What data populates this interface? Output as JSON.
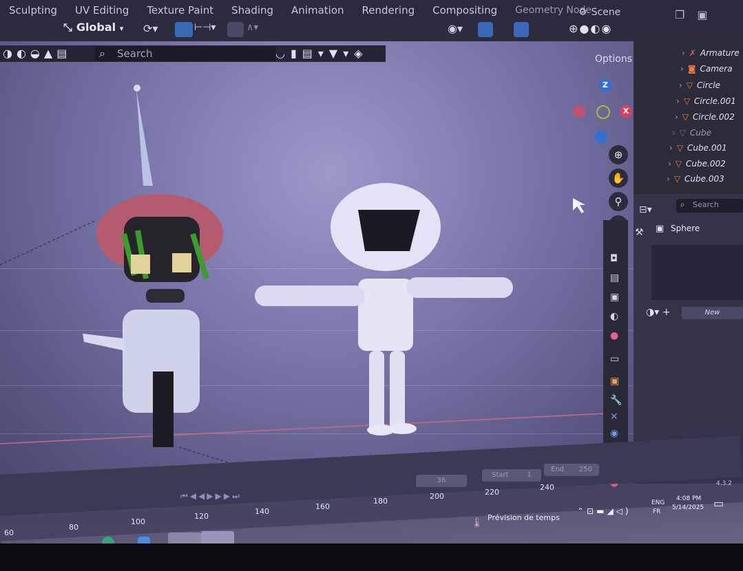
{
  "workspace_tabs": [
    "Sculpting",
    "UV Editing",
    "Texture Paint",
    "Shading",
    "Animation",
    "Rendering",
    "Compositing",
    "Geometry Node"
  ],
  "scene_label": "Scene",
  "header": {
    "orientation": "Global"
  },
  "viewport": {
    "search_placeholder": "Search",
    "options_label": "Options"
  },
  "gizmo": {
    "z": "Z",
    "x": "X"
  },
  "outliner": {
    "items": [
      "Armature",
      "Camera",
      "Circle",
      "Circle.001",
      "Circle.002",
      "Cube",
      "Cube.001",
      "Cube.002",
      "Cube.003"
    ]
  },
  "properties": {
    "search_placeholder": "Search",
    "object_name": "Sphere",
    "new_button": "New"
  },
  "timeline": {
    "current_frame": "36",
    "start_label": "Start",
    "start_value": "1",
    "end_label": "End",
    "end_value": "250",
    "frame_numbers": [
      "60",
      "80",
      "100",
      "120",
      "140",
      "160",
      "180",
      "200",
      "220",
      "240"
    ]
  },
  "version": "4.3.2",
  "taskbar": {
    "weather": "Prévision de temps",
    "lang_line1": "ENG",
    "lang_line2": "FR",
    "time": "4:08 PM",
    "date": "5/14/2025"
  },
  "colors": {
    "accent_orange": "#ef7d3c",
    "axis_x": "#d9405f",
    "axis_y": "#9ac430",
    "axis_z": "#2f6fd6"
  }
}
